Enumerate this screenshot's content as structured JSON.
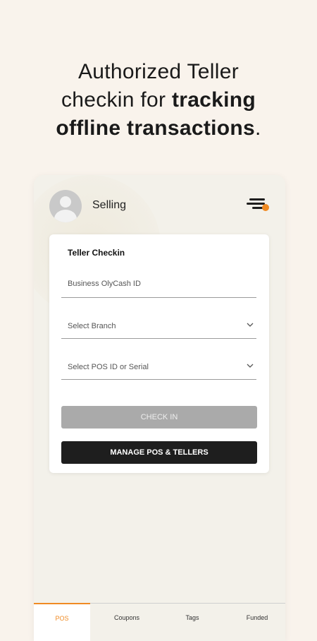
{
  "headline": {
    "line1": "Authorized Teller",
    "line2_normal": "checkin for ",
    "line2_bold": "tracking",
    "line3_bold": "offline transactions",
    "line3_end": "."
  },
  "appbar": {
    "title": "Selling",
    "menu_icon": "hamburger-menu-icon",
    "badge_color": "#f08b24"
  },
  "card": {
    "title": "Teller Checkin",
    "business_id": {
      "placeholder": "Business OlyCash ID",
      "value": ""
    },
    "branch": {
      "placeholder": "Select Branch",
      "value": ""
    },
    "pos": {
      "placeholder": "Select POS ID or Serial",
      "value": ""
    },
    "check_in_label": "CHECK IN",
    "manage_label": "MANAGE POS & TELLERS"
  },
  "tabs": [
    {
      "label": "POS",
      "active": true
    },
    {
      "label": "Coupons",
      "active": false
    },
    {
      "label": "Tags",
      "active": false
    },
    {
      "label": "Funded",
      "active": false
    }
  ],
  "colors": {
    "accent": "#f08b24",
    "page_bg": "#f9f3ec",
    "dark_button": "#1e1e1e",
    "disabled_button": "#aaaaaa"
  }
}
